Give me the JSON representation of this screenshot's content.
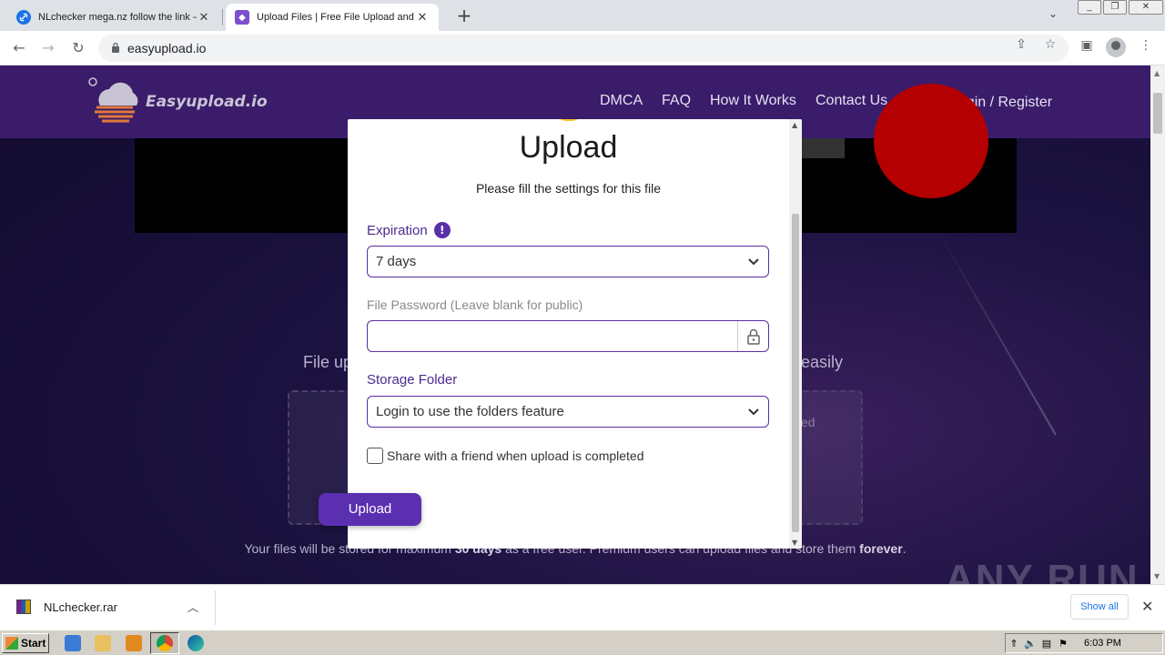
{
  "browser": {
    "tabs": [
      {
        "title": "NLchecker mega.nz follow the link —",
        "favicon": "link-icon",
        "active": false
      },
      {
        "title": "Upload Files | Free File Upload and T",
        "favicon": "easyupload-icon",
        "active": true
      }
    ],
    "new_tab": "+",
    "address": "easyupload.io"
  },
  "site": {
    "logo_text": "Easyupload.io",
    "nav": {
      "dmca": "DMCA",
      "faq": "FAQ",
      "how": "How It Works",
      "contact": "Contact Us",
      "login": "Login / Register"
    },
    "hero_left": "File up",
    "hero_right": "easily",
    "dropzone_fragment": "ed",
    "footer": {
      "part1": "Your files will be stored for maximum ",
      "days": "30 days",
      "part2": " as a free user. Premium users can upload files and store them ",
      "forever": "forever",
      "end": "."
    },
    "watermark": "ANY RUN"
  },
  "modal": {
    "title": "Upload",
    "subtitle": "Please fill the settings for this file",
    "expiration": {
      "label": "Expiration",
      "info_icon": "!",
      "value": "7 days"
    },
    "password": {
      "label": "File Password (Leave blank for public)",
      "value": ""
    },
    "folder": {
      "label": "Storage Folder",
      "value": "Login to use the folders feature"
    },
    "share": {
      "label": "Share with a friend when upload is completed",
      "checked": false
    },
    "upload_button": "Upload"
  },
  "downloads": {
    "file": "NLchecker.rar",
    "show_all": "Show all"
  },
  "taskbar": {
    "start": "Start",
    "clock": "6:03 PM"
  },
  "colors": {
    "accent": "#5a2fb0",
    "header": "#3a1c6b"
  }
}
